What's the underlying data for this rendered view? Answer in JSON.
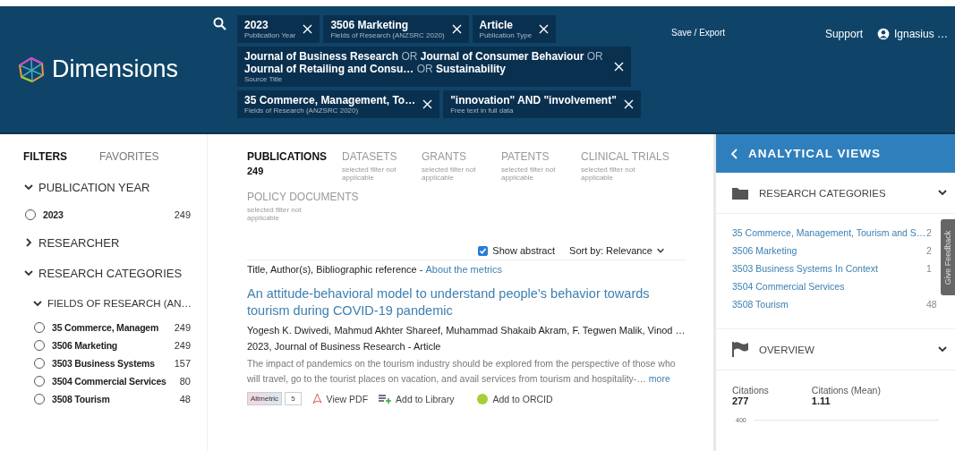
{
  "header": {
    "logo": "Dimensions",
    "chip_rows": [
      [
        {
          "title": "2023",
          "subtitle": "Publication Year"
        },
        {
          "title": "3506 Marketing",
          "subtitle": "Fields of Research (ANZSRC 2020)"
        },
        {
          "title": "Article",
          "subtitle": "Publication Type"
        }
      ],
      [
        {
          "title": "Journal of Business Research **OR** Journal of Consumer Behaviour **OR**",
          "title2": "Journal of Retailing and Consu…  **OR** Sustainability",
          "subtitle": "Source Title"
        }
      ],
      [
        {
          "title": "35 Commerce, Management, To…",
          "subtitle": "Fields of Research (ANZSRC 2020)"
        },
        {
          "title": "\"innovation\" AND \"involvement\"",
          "subtitle": "Free text in full data"
        }
      ]
    ],
    "save_export": "Save / Export",
    "support": "Support",
    "user": "Ignasius …"
  },
  "sidebar": {
    "tabs": [
      {
        "label": "FILTERS",
        "selected": true
      },
      {
        "label": "FAVORITES",
        "selected": false
      }
    ],
    "sections": [
      {
        "label": "PUBLICATION YEAR",
        "expanded": true,
        "items": [
          {
            "label": "2023",
            "count": "249",
            "selected": false
          }
        ]
      },
      {
        "label": "RESEARCHER",
        "expanded": false
      },
      {
        "label": "RESEARCH CATEGORIES",
        "expanded": true,
        "children": [
          {
            "label": "FIELDS OF RESEARCH (AN…",
            "expanded": true,
            "items": [
              {
                "label": "35 Commerce, Managem",
                "count": "249",
                "selected": false
              },
              {
                "label": "3506 Marketing",
                "count": "249",
                "selected": false
              },
              {
                "label": "3503 Business Systems",
                "count": "157",
                "selected": false
              },
              {
                "label": "3504 Commercial Services",
                "count": "80",
                "selected": false
              },
              {
                "label": "3508 Tourism",
                "count": "48",
                "selected": false
              }
            ]
          }
        ]
      }
    ]
  },
  "results": {
    "tabs": [
      {
        "label": "PUBLICATIONS",
        "sub": "249",
        "selected": true
      },
      {
        "label": "DATASETS",
        "sub": "selected filter not applicable",
        "selected": false
      },
      {
        "label": "GRANTS",
        "sub": "selected filter not applicable",
        "selected": false
      },
      {
        "label": "PATENTS",
        "sub": "selected filter not applicable",
        "selected": false
      },
      {
        "label": "CLINICAL TRIALS",
        "sub": "selected filter not applicable",
        "selected": false
      },
      {
        "label": "POLICY DOCUMENTS",
        "sub": "selected filter not applicable",
        "selected": false
      }
    ],
    "show_abstract": {
      "label": "Show abstract",
      "checked": true
    },
    "sort": {
      "label": "Sort by:",
      "value": "Relevance"
    },
    "legend": "Title, Author(s), Bibliographic reference -",
    "legend_link": "About the metrics",
    "items": [
      {
        "title": "An attitude-behavioral model to understand people’s behavior towards tourism during COVID-19 pandemic",
        "authors": "Yogesh K. Dwivedi, Mahmud Akhter Shareef, Muhammad Shakaib Akram, F. Tegwen Malik, Vinod …",
        "reference": "2023, Journal of Business Research - Article",
        "abstract": "The impact of pandemics on the tourism industry should be explored from the perspective of those who will travel, go to the tourist places on vacation, and avail services from tourism and hospitality-…",
        "more": "more",
        "altmetric": "Altmetric",
        "altmetric_score": "5",
        "view_pdf": "View PDF",
        "add_library": "Add to Library",
        "add_orcid": "Add to ORCID"
      }
    ]
  },
  "analytical": {
    "title": "ANALYTICAL VIEWS",
    "sections": [
      {
        "kind": "list",
        "title": "RESEARCH CATEGORIES",
        "expanded": true,
        "items": [
          {
            "label": "35 Commerce, Management, Tourism and S…",
            "count": "2"
          },
          {
            "label": "3506 Marketing",
            "count": "2"
          },
          {
            "label": "3503 Business Systems In Context",
            "count": "1"
          },
          {
            "label": "3504 Commercial Services"
          },
          {
            "label": "3508 Tourism",
            "count": "48"
          }
        ]
      },
      {
        "kind": "stats",
        "title": "OVERVIEW",
        "expanded": true,
        "stats": [
          {
            "label": "Citations",
            "value": "277"
          },
          {
            "label": "Citations (Mean)",
            "value": "1.11"
          }
        ],
        "axis_label": "400"
      }
    ],
    "feedback": "Give Feedback"
  }
}
